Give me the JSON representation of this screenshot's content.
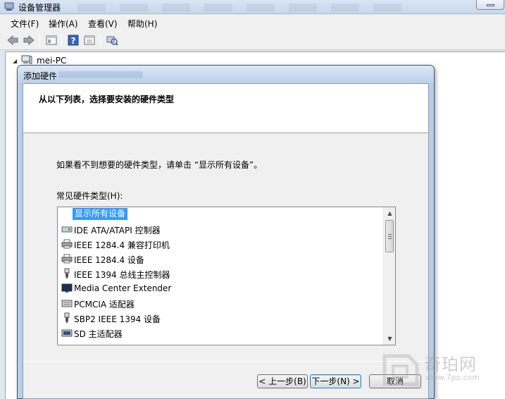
{
  "app": {
    "title": "设备管理器",
    "menu": [
      "文件(F)",
      "操作(A)",
      "查看(V)",
      "帮助(H)"
    ],
    "toolbar_icons": [
      "back-arrow-icon",
      "forward-arrow-icon",
      "properties-icon",
      "help-icon",
      "view-icon",
      "scan-hardware-icon"
    ],
    "tree_root": "mei-PC"
  },
  "wizard": {
    "title": "添加硬件",
    "heading": "从以下列表，选择要安装的硬件类型",
    "hint": "如果看不到想要的硬件类型，请单击 “显示所有设备”。",
    "types_label": "常见硬件类型(H):",
    "items": [
      {
        "label": "显示所有设备",
        "icon": "none",
        "selected": true
      },
      {
        "label": "IDE ATA/ATAPI 控制器",
        "icon": "ide-controller-icon",
        "selected": false
      },
      {
        "label": "IEEE 1284.4 兼容打印机",
        "icon": "printer-icon",
        "selected": false
      },
      {
        "label": "IEEE 1284.4 设备",
        "icon": "printer-icon",
        "selected": false
      },
      {
        "label": "IEEE 1394 总线主控制器",
        "icon": "usb-plug-icon",
        "selected": false
      },
      {
        "label": "Media Center Extender",
        "icon": "monitor-icon",
        "selected": false
      },
      {
        "label": "PCMCIA 适配器",
        "icon": "pcmcia-card-icon",
        "selected": false
      },
      {
        "label": "SBP2 IEEE 1394 设备",
        "icon": "usb-plug-icon",
        "selected": false
      },
      {
        "label": "SD 主适配器",
        "icon": "sd-adapter-icon",
        "selected": false
      }
    ],
    "buttons": {
      "back": "< 上一步(B)",
      "next": "下一步(N) >",
      "cancel": "取消"
    }
  },
  "watermark": {
    "text": "奇珀网",
    "url": "www.7po.com"
  }
}
